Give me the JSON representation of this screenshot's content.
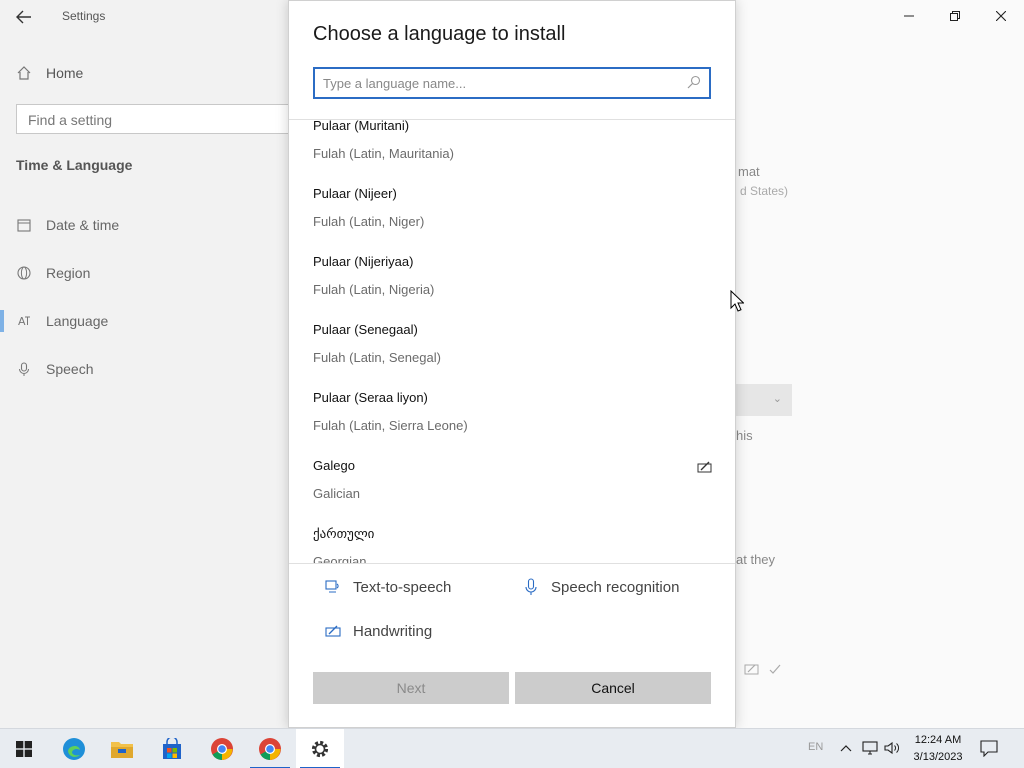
{
  "settings": {
    "title": "Settings",
    "home_label": "Home",
    "search_placeholder": "Find a setting",
    "section_title": "Time & Language",
    "nav": [
      {
        "label": "Date & time",
        "icon": "calendar-clock-icon"
      },
      {
        "label": "Region",
        "icon": "globe-icon"
      },
      {
        "label": "Language",
        "icon": "language-icon"
      },
      {
        "label": "Speech",
        "icon": "microphone-icon"
      }
    ],
    "active_nav": "Language",
    "background_text": {
      "format": "mat",
      "region": "d States)",
      "this": "his",
      "that_they": "at they"
    }
  },
  "dialog": {
    "title": "Choose a language to install",
    "search_placeholder": "Type a language name...",
    "languages": [
      {
        "native": "Pulaar (Muritani)",
        "english": "Fulah (Latin, Mauritania)",
        "handwriting": false
      },
      {
        "native": "Pulaar (Nijeer)",
        "english": "Fulah (Latin, Niger)",
        "handwriting": false
      },
      {
        "native": "Pulaar (Nijeriyaa)",
        "english": "Fulah (Latin, Nigeria)",
        "handwriting": false
      },
      {
        "native": "Pulaar (Senegaal)",
        "english": "Fulah (Latin, Senegal)",
        "handwriting": false
      },
      {
        "native": "Pulaar (Seraa liyon)",
        "english": "Fulah (Latin, Sierra Leone)",
        "handwriting": false
      },
      {
        "native": "Galego",
        "english": "Galician",
        "handwriting": true
      },
      {
        "native": "ქართული",
        "english": "Georgian",
        "handwriting": false
      }
    ],
    "features": {
      "tts": "Text-to-speech",
      "speech_recognition": "Speech recognition",
      "handwriting": "Handwriting"
    },
    "buttons": {
      "next": "Next",
      "cancel": "Cancel"
    }
  },
  "taskbar": {
    "apps": [
      "start-icon",
      "edge-icon",
      "file-explorer-icon",
      "store-icon",
      "chrome-icon",
      "chrome-icon",
      "settings-gear-icon"
    ],
    "input_language": "EN",
    "time": "12:24 AM",
    "date": "3/13/2023"
  },
  "colors": {
    "accent": "#2b6cc4",
    "nav_accent": "#7fb2e6",
    "button_bg": "#cccccc",
    "taskbar_bg": "#e8ecf1"
  }
}
